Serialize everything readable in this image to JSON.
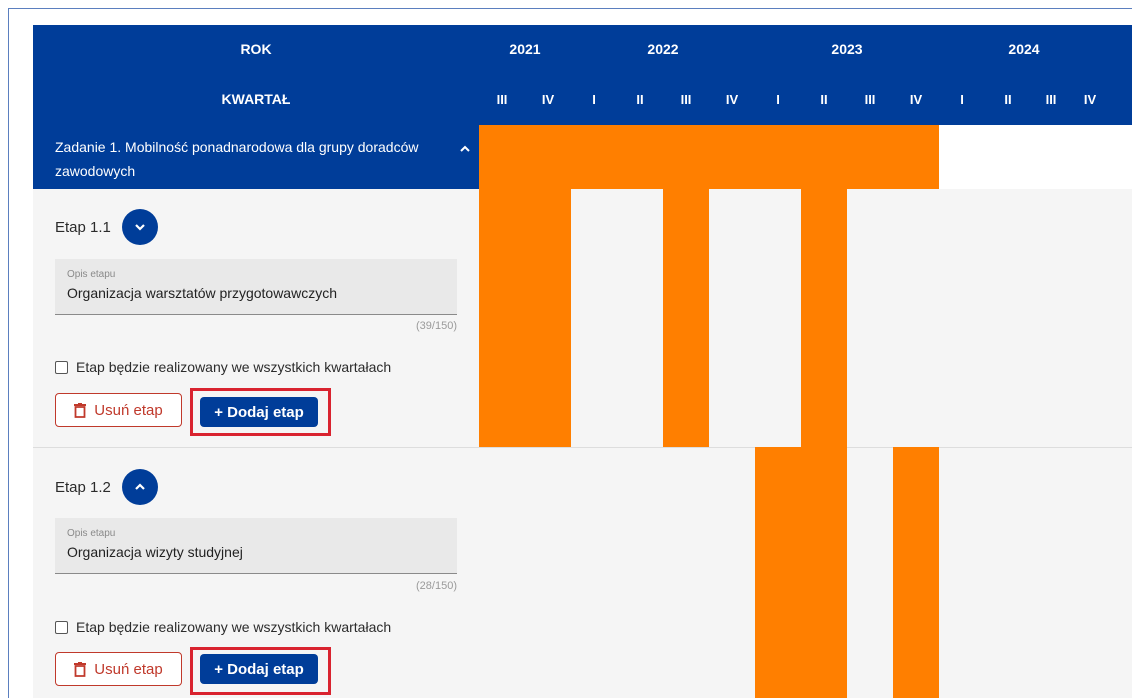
{
  "header": {
    "rok_label": "ROK",
    "kwartal_label": "KWARTAŁ",
    "years": [
      "2021",
      "2022",
      "2023",
      "2024"
    ],
    "quarters": [
      "III",
      "IV",
      "I",
      "II",
      "III",
      "IV",
      "I",
      "II",
      "III",
      "IV",
      "I",
      "II",
      "III",
      "IV"
    ]
  },
  "task": {
    "title": "Zadanie 1. Mobilność ponadnarodowa dla grupy doradców zawodowych",
    "toggle_icon": "chevron-up-icon",
    "active_quarters": [
      0,
      1,
      2,
      3,
      4,
      5,
      6,
      7,
      8,
      9
    ]
  },
  "stages": [
    {
      "label": "Etap 1.1",
      "toggle_icon": "chevron-down-icon",
      "field_label": "Opis etapu",
      "field_value": "Organizacja warsztatów przygotowawczych",
      "counter": "(39/150)",
      "checkbox_label": "Etap będzie realizowany we wszystkich kwartałach",
      "checkbox_checked": false,
      "delete_label": "Usuń etap",
      "add_label": "+ Dodaj etap",
      "active_quarters": [
        0,
        1,
        4,
        7
      ]
    },
    {
      "label": "Etap 1.2",
      "toggle_icon": "chevron-up-icon",
      "field_label": "Opis etapu",
      "field_value": "Organizacja wizyty studyjnej",
      "counter": "(28/150)",
      "checkbox_label": "Etap będzie realizowany we wszystkich kwartałach",
      "checkbox_checked": false,
      "delete_label": "Usuń etap",
      "add_label": "+ Dodaj etap",
      "active_quarters": [
        6,
        7,
        9
      ]
    }
  ],
  "colors": {
    "header_blue": "#003d99",
    "bar_orange": "#ff7f00",
    "delete_red": "#c0392b",
    "highlight_red": "#d9232f"
  }
}
